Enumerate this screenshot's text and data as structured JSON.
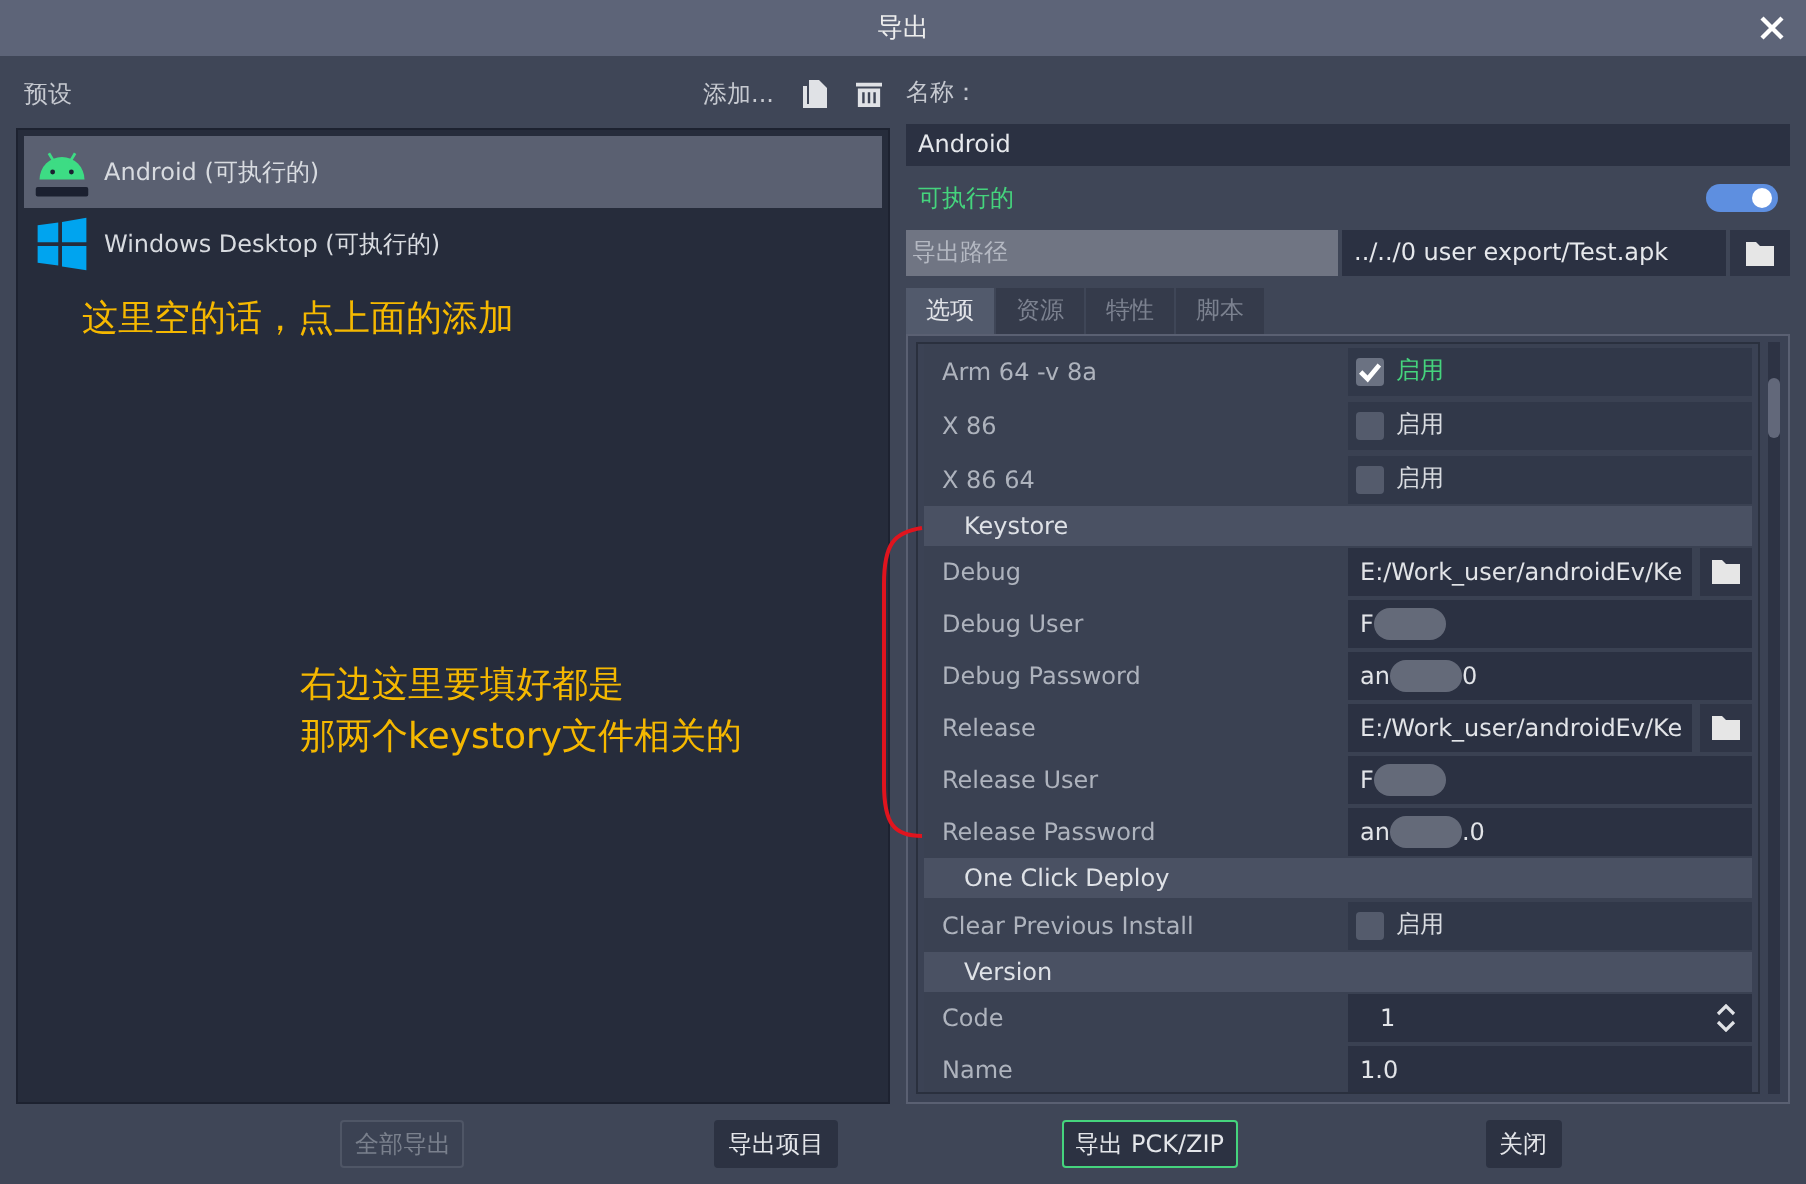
{
  "window": {
    "title": "导出"
  },
  "presets": {
    "label": "预设",
    "add": "添加...",
    "items": [
      {
        "name": "Android (可执行的)",
        "kind": "android",
        "selected": true
      },
      {
        "name": "Windows Desktop (可执行的)",
        "kind": "windows",
        "selected": false
      }
    ]
  },
  "details": {
    "name_label": "名称：",
    "name_value": "Android",
    "runnable_label": "可执行的",
    "runnable_on": true,
    "export_path_label": "导出路径",
    "export_path_value": "../../0 user export/Test.apk"
  },
  "tabs": [
    {
      "label": "选项",
      "selected": true
    },
    {
      "label": "资源",
      "selected": false
    },
    {
      "label": "特性",
      "selected": false
    },
    {
      "label": "脚本",
      "selected": false
    }
  ],
  "options": [
    {
      "kind": "checkbox",
      "label": "Arm 64 -v 8a",
      "text": "启用",
      "checked": true
    },
    {
      "kind": "checkbox",
      "label": "X 86",
      "text": "启用",
      "checked": false
    },
    {
      "kind": "checkbox",
      "label": "X 86 64",
      "text": "启用",
      "checked": false
    },
    {
      "kind": "section",
      "label": "Keystore"
    },
    {
      "kind": "path",
      "label": "Debug",
      "value": "E:/Work_user/androidEv/Ke"
    },
    {
      "kind": "text",
      "label": "Debug User",
      "value": "F",
      "redacted": true
    },
    {
      "kind": "text",
      "label": "Debug Password",
      "value": "an",
      "tail": "0",
      "redacted": true
    },
    {
      "kind": "path",
      "label": "Release",
      "value": "E:/Work_user/androidEv/Ke"
    },
    {
      "kind": "text",
      "label": "Release User",
      "value": "F",
      "redacted": true
    },
    {
      "kind": "text",
      "label": "Release Password",
      "value": "an",
      "tail": ".0",
      "redacted": true
    },
    {
      "kind": "section",
      "label": "One Click Deploy"
    },
    {
      "kind": "checkbox",
      "label": "Clear Previous Install",
      "text": "启用",
      "checked": false
    },
    {
      "kind": "section",
      "label": "Version"
    },
    {
      "kind": "spin",
      "label": "Code",
      "value": "1"
    },
    {
      "kind": "text",
      "label": "Name",
      "value": "1.0",
      "redacted": false
    }
  ],
  "buttons": [
    {
      "label": "全部导出",
      "disabled": true,
      "primary": false
    },
    {
      "label": "导出项目",
      "disabled": false,
      "primary": false
    },
    {
      "label": "导出 PCK/ZIP",
      "disabled": false,
      "primary": true
    },
    {
      "label": "关闭",
      "disabled": false,
      "primary": false
    }
  ],
  "annotations": {
    "left": "这里空的话，点上面的添加",
    "right": [
      "右边这里要填好都是",
      "那两个keystory文件相关的"
    ]
  }
}
